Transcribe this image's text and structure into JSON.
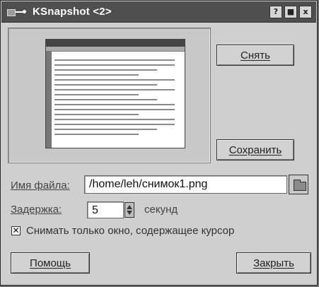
{
  "window": {
    "title": "KSnapshot <2>",
    "controls": [
      "?",
      "■",
      "x"
    ]
  },
  "buttons": {
    "snap": "Снять",
    "save": "Сохранить",
    "help": "Помощь",
    "close": "Закрыть"
  },
  "filename": {
    "label": "Имя файла:",
    "value": "/home/leh/снимок1.png"
  },
  "delay": {
    "label": "Задержка:",
    "value": "5",
    "unit": "секунд"
  },
  "options": {
    "window_only_label": "Снимать только окно, содержащее курсор",
    "window_only_checked": true
  }
}
